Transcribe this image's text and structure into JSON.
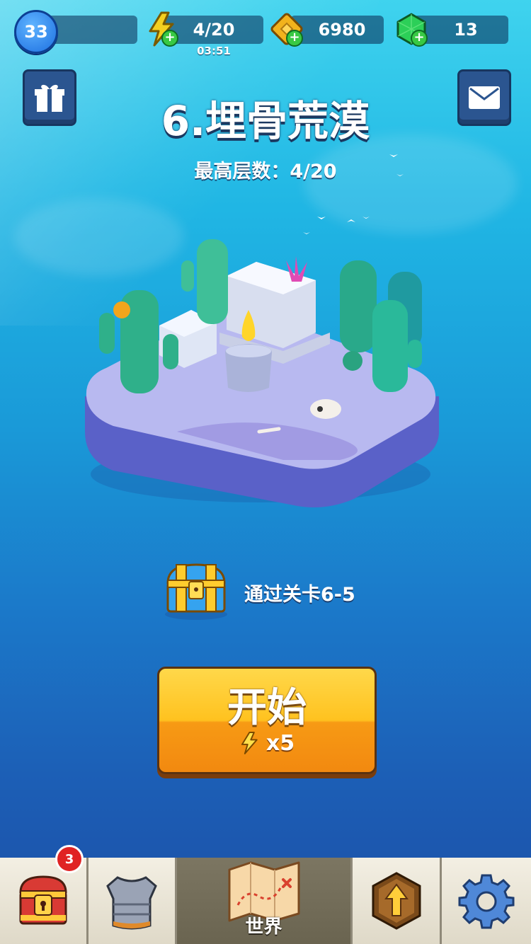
{
  "player": {
    "level": "33"
  },
  "resources": {
    "energy": "4/20",
    "energy_timer": "03:51",
    "gold": "6980",
    "gems": "13"
  },
  "stage": {
    "title": "6.埋骨荒漠",
    "best_floor": "最高层数：4/20"
  },
  "reward": {
    "text": "通过关卡6-5"
  },
  "start_button": {
    "label": "开始",
    "cost": "x5"
  },
  "nav": {
    "items": [
      {
        "id": "chest",
        "badge": "3"
      },
      {
        "id": "armor"
      },
      {
        "id": "world",
        "label": "世界"
      },
      {
        "id": "upgrade"
      },
      {
        "id": "settings"
      }
    ]
  },
  "colors": {
    "energy": "#f5d020",
    "gold": "#f2b31c",
    "gem": "#2ccf58",
    "start_button": "#ffc21f",
    "badge": "#e02323"
  }
}
